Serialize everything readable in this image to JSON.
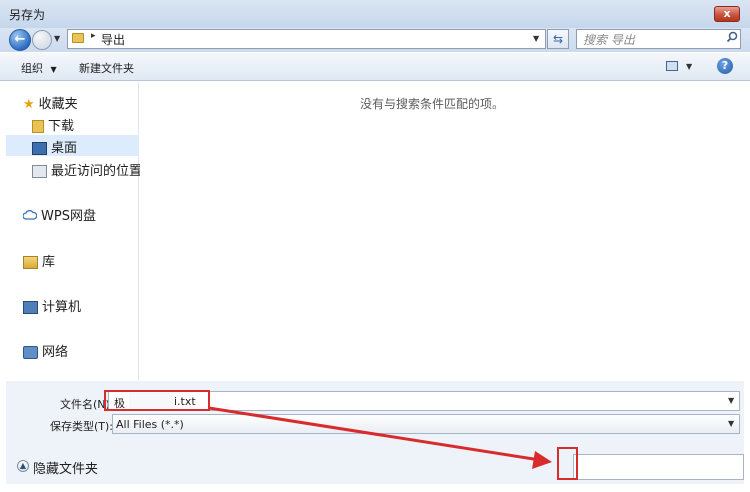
{
  "window": {
    "title": "另存为",
    "close_label": "x"
  },
  "nav": {
    "back_label": "←",
    "address": {
      "chevron": "▸",
      "current": "导出"
    },
    "refresh_label": "⇆",
    "search_placeholder": "搜索 导出"
  },
  "toolbar": {
    "organize_label": "组织",
    "new_folder_label": "新建文件夹",
    "help_label": "?",
    "dropdown_glyph": "▼"
  },
  "sidebar": {
    "items": [
      {
        "label": "收藏夹",
        "icon": "star-icon"
      },
      {
        "label": "下载",
        "icon": "folder-icon"
      },
      {
        "label": "桌面",
        "icon": "desktop-icon",
        "selected": true
      },
      {
        "label": "最近访问的位置",
        "icon": "recent-places-icon"
      },
      {
        "label": "WPS网盘",
        "icon": "cloud-icon"
      },
      {
        "label": "库",
        "icon": "library-icon"
      },
      {
        "label": "计算机",
        "icon": "computer-icon"
      },
      {
        "label": "网络",
        "icon": "network-icon"
      }
    ]
  },
  "content": {
    "empty_message": "没有与搜索条件匹配的项。"
  },
  "form": {
    "filename_label": "文件名(N):",
    "filename_value": "极",
    "filename_suffix": "i.txt",
    "filetype_label": "保存类型(T):",
    "filetype_value": "All Files (*.*)"
  },
  "footer": {
    "hide_folders_label": "隐藏文件夹",
    "hide_glyph": "▲"
  },
  "colors": {
    "annotation_red": "#d92b2b",
    "selection": "#dcecfc"
  }
}
